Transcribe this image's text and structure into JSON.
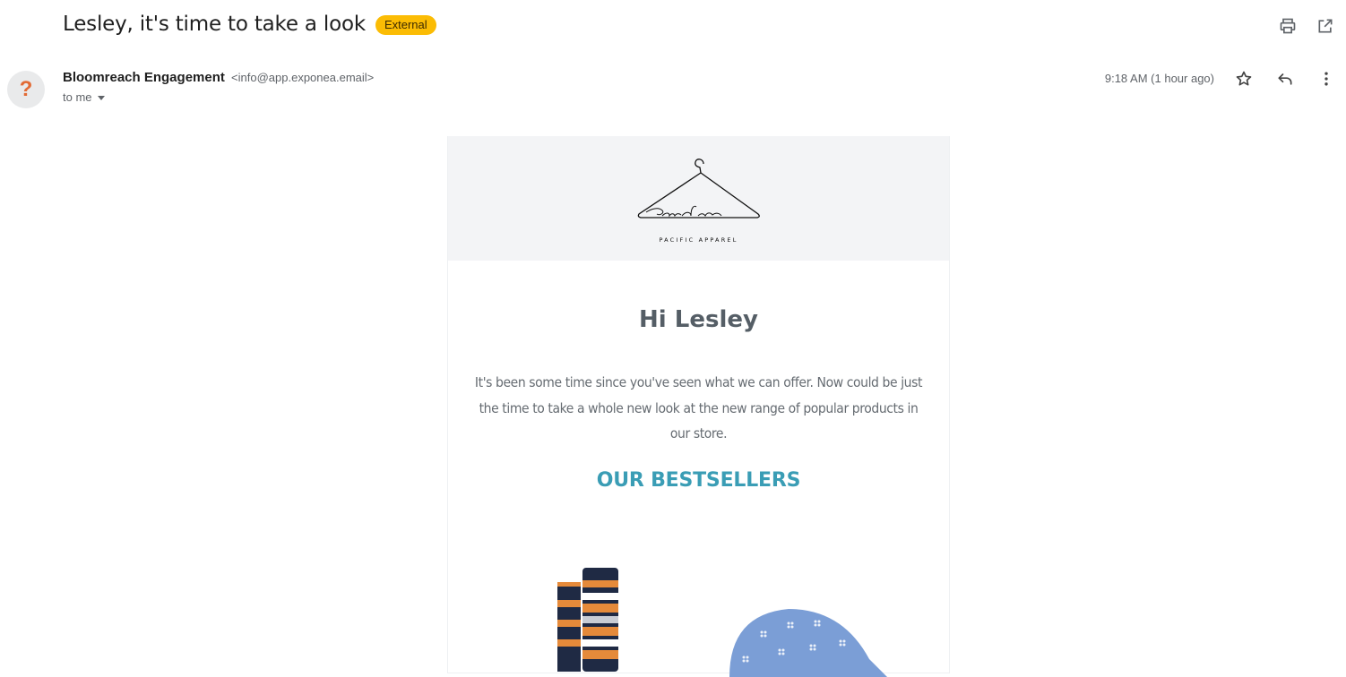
{
  "email": {
    "subject": "Lesley, it's time to take a look",
    "badge": "External",
    "sender_name": "Bloomreach Engagement",
    "sender_email": "<info@app.exponea.email>",
    "recipient": "to me",
    "timestamp": "9:18 AM (1 hour ago)",
    "avatar_glyph": "?"
  },
  "icons": {
    "print": "print-icon",
    "open_new_window": "open-in-new-window-icon",
    "star": "star-icon",
    "reply": "reply-icon",
    "more": "more-vert-icon"
  },
  "colors": {
    "badge": "#fbbc04",
    "heading": "#555e66",
    "accent": "#3a9db5",
    "header_bg": "#f3f4f6"
  },
  "content": {
    "logo_script": "pacific",
    "brand_caption": "PACIFIC APPAREL",
    "greeting": "Hi Lesley",
    "body": "It's been some time since you've seen what we can offer. Now could be just the time to take a whole new look at the new range of popular products in our store.",
    "section_title": "OUR BESTSELLERS",
    "products": [
      {
        "image": "striped-socks-image"
      },
      {
        "image": "denim-cap-image"
      }
    ]
  }
}
